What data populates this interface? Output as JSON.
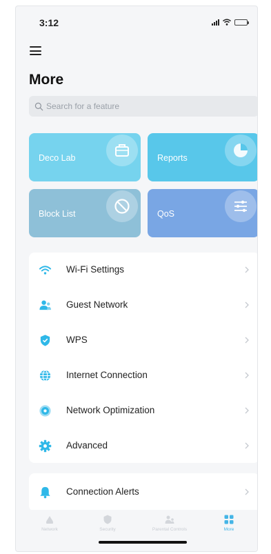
{
  "status_bar": {
    "time": "3:12"
  },
  "page": {
    "title": "More"
  },
  "search": {
    "placeholder": "Search for a feature"
  },
  "tiles": [
    {
      "label": "Deco Lab",
      "icon": "toolbox-icon",
      "color": "#76d3ee"
    },
    {
      "label": "Reports",
      "icon": "pie-chart-icon",
      "color": "#58c7ea"
    },
    {
      "label": "Block List",
      "icon": "block-icon",
      "color": "#8ec0d8"
    },
    {
      "label": "QoS",
      "icon": "sliders-icon",
      "color": "#79a6e4"
    }
  ],
  "menu": [
    {
      "label": "Wi-Fi Settings",
      "icon": "wifi-icon"
    },
    {
      "label": "Guest Network",
      "icon": "guest-users-icon"
    },
    {
      "label": "WPS",
      "icon": "shield-icon"
    },
    {
      "label": "Internet Connection",
      "icon": "globe-icon"
    },
    {
      "label": "Network Optimization",
      "icon": "optimization-icon"
    },
    {
      "label": "Advanced",
      "icon": "gear-icon"
    }
  ],
  "menu2": [
    {
      "label": "Connection Alerts",
      "icon": "bell-icon"
    }
  ],
  "tabbar": [
    {
      "label": "Network",
      "icon": "network-icon",
      "active": false
    },
    {
      "label": "Security",
      "icon": "security-icon",
      "active": false
    },
    {
      "label": "Parental Controls",
      "icon": "parental-controls-icon",
      "active": false
    },
    {
      "label": "More",
      "icon": "more-grid-icon",
      "active": true
    }
  ],
  "colors": {
    "accent": "#2fb8e8",
    "background": "#f5f6f8",
    "card": "#ffffff"
  }
}
